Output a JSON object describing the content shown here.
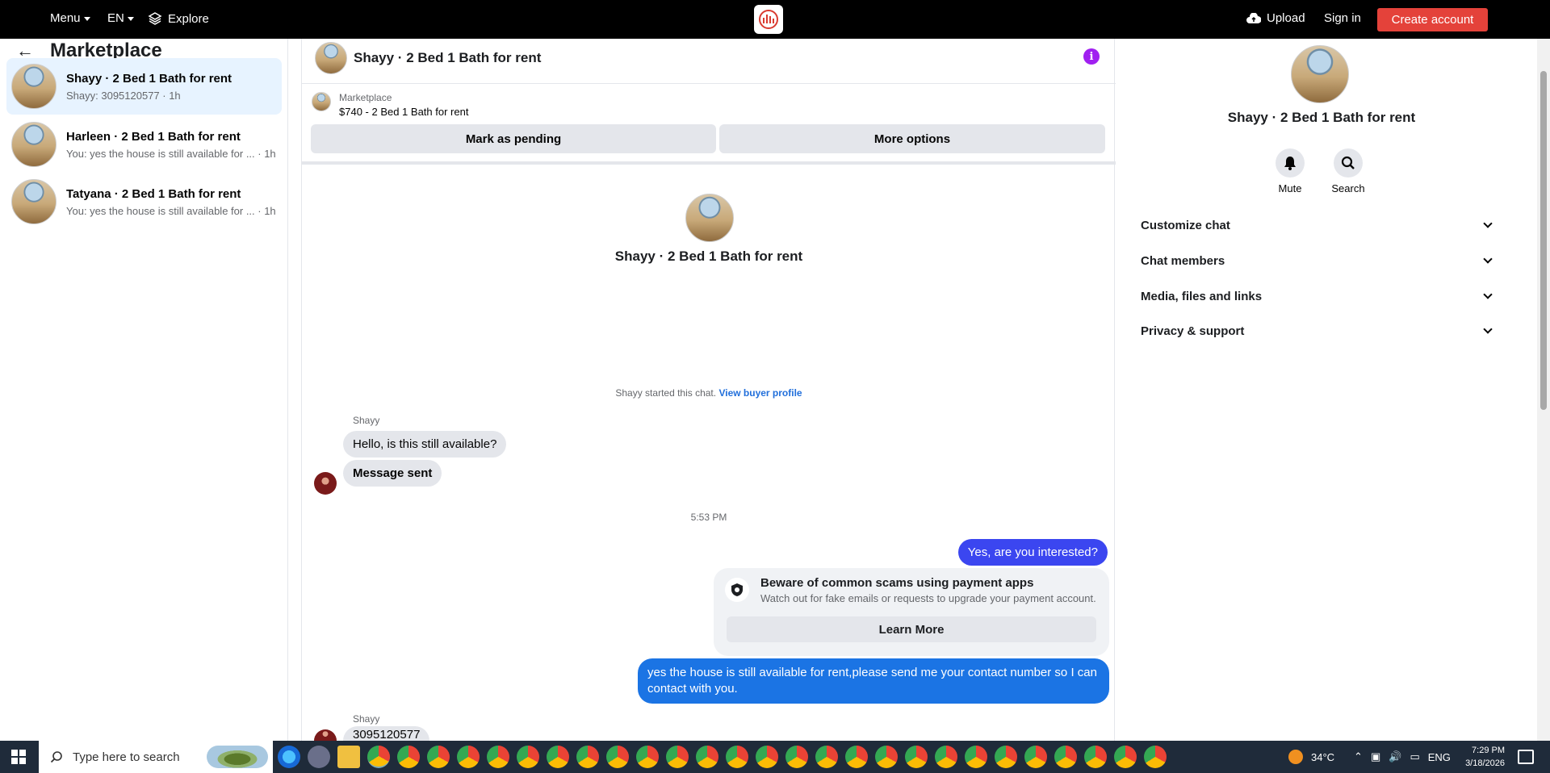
{
  "topnav": {
    "menu": "Menu",
    "lang": "EN",
    "explore": "Explore",
    "upload": "Upload",
    "signin": "Sign in",
    "create": "Create account",
    "accent_color": "#e4423a"
  },
  "sidebar": {
    "title": "Marketplace",
    "conversations": [
      {
        "title": "Shayy · 2 Bed 1 Bath for rent",
        "subtitle": "Shayy: 3095120577 · 1h"
      },
      {
        "title": "Harleen · 2 Bed 1 Bath for rent",
        "subtitle": "You: yes the house is still available for ... · 1h"
      },
      {
        "title": "Tatyana · 2 Bed 1 Bath for rent",
        "subtitle": "You: yes the house is still available for ... · 1h"
      }
    ]
  },
  "chat": {
    "title": "Shayy · 2 Bed 1 Bath for rent",
    "listing_label": "Marketplace",
    "listing_value": "$740 - 2 Bed 1 Bath for rent",
    "mark_pending": "Mark as pending",
    "more_options": "More options",
    "hero_title": "Shayy · 2 Bed 1 Bath for rent",
    "started_text": "Shayy started this chat.",
    "view_buyer": "View buyer profile",
    "sender_name": "Shayy",
    "msg1": "Hello, is this still available?",
    "msg2": "Message sent",
    "time": "5:53 PM",
    "reply1": "Yes, are you interested?",
    "warning_title": "Beware of common scams using payment apps",
    "warning_sub": "Watch out for fake emails or requests to upgrade your payment account.",
    "learn_more": "Learn More",
    "reply2_line1": "yes the house is still available for rent,please send me your contact number so I can",
    "reply2_line2": "contact with you.",
    "sender_name2": "Shayy",
    "partial_msg": "3095120577"
  },
  "right": {
    "title": "Shayy · 2 Bed 1 Bath for rent",
    "mute": "Mute",
    "search": "Search",
    "sections": [
      "Customize chat",
      "Chat members",
      "Media, files and links",
      "Privacy & support"
    ]
  },
  "taskbar": {
    "search_placeholder": "Type here to search",
    "temp": "34°C",
    "lang": "ENG",
    "time": "7:29 PM",
    "date": "3/18/2026"
  }
}
